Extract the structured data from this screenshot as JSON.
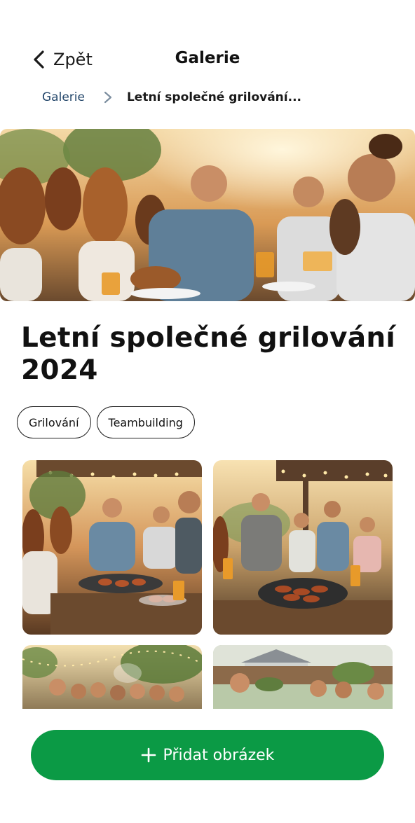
{
  "header": {
    "back_label": "Zpět",
    "title": "Galerie",
    "back_icon": "chevron-left-icon"
  },
  "breadcrumb": {
    "root": "Galerie",
    "separator_icon": "chevron-right-icon",
    "current": "Letní společné grilování..."
  },
  "album": {
    "title": "Letní společné grilování 2024",
    "tags": [
      "Grilování",
      "Teambuilding"
    ]
  },
  "photos": [
    {
      "subject": "group of friends at a sunset barbecue holding drinks and burgers"
    },
    {
      "subject": "people around a round grill with sausages under string lights"
    },
    {
      "subject": "group selfie in a garden with string lights"
    },
    {
      "subject": "friends laughing in a backyard by a fence"
    }
  ],
  "actions": {
    "add_image_label": "Přidat obrázek",
    "add_icon": "plus-icon"
  },
  "colors": {
    "accent": "#0b9a45",
    "breadcrumb_link": "#23466a"
  }
}
